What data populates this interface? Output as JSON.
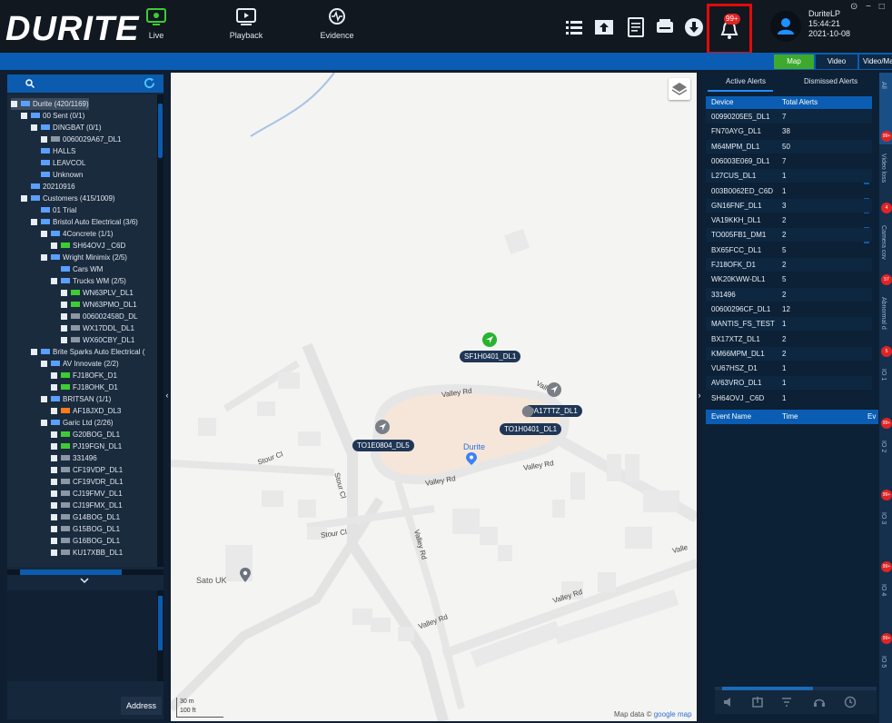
{
  "app": {
    "brand": "DURITE",
    "registered_mark": "®",
    "accent": "#0a5db2",
    "alert_color": "#e02424"
  },
  "nav": [
    {
      "label": "Live",
      "icon": "live-icon"
    },
    {
      "label": "Playback",
      "icon": "playback-icon"
    },
    {
      "label": "Evidence",
      "icon": "evidence-icon"
    }
  ],
  "header_icons": [
    "list-icon",
    "upload-icon",
    "report-icon",
    "printer-icon",
    "download-icon",
    "bell-icon"
  ],
  "bell": {
    "badge": "99+"
  },
  "user": {
    "name": "DuriteLP",
    "time": "15:44:21",
    "date": "2021-10-08"
  },
  "window_controls": "⊙ − □",
  "view_tabs": {
    "map": "Map",
    "video": "Video",
    "videomap": "Video/Ma"
  },
  "tree": [
    {
      "label": "Durite (420/1169)",
      "level": 0,
      "icon": "group"
    },
    {
      "label": "00 Sent (0/1)",
      "level": 1,
      "icon": "group"
    },
    {
      "label": "DINGBAT (0/1)",
      "level": 2,
      "icon": "group"
    },
    {
      "label": "0060029A67_DL1",
      "level": 3,
      "icon": "vehicle-grey"
    },
    {
      "label": "HALLS",
      "level": 2,
      "icon": "group"
    },
    {
      "label": "LEAVCOL",
      "level": 2,
      "icon": "group"
    },
    {
      "label": "Unknown",
      "level": 2,
      "icon": "group"
    },
    {
      "label": "20210916",
      "level": 1,
      "icon": "group"
    },
    {
      "label": "Customers (415/1009)",
      "level": 1,
      "icon": "group"
    },
    {
      "label": "01 Trial",
      "level": 2,
      "icon": "group"
    },
    {
      "label": "Bristol Auto Electrical (3/6)",
      "level": 2,
      "icon": "group"
    },
    {
      "label": "4Concrete (1/1)",
      "level": 3,
      "icon": "group"
    },
    {
      "label": "SH64OVJ _C6D",
      "level": 4,
      "icon": "vehicle-green"
    },
    {
      "label": "Wright Minimix (2/5)",
      "level": 3,
      "icon": "group"
    },
    {
      "label": "Cars WM",
      "level": 4,
      "icon": "group"
    },
    {
      "label": "Trucks WM (2/5)",
      "level": 4,
      "icon": "group"
    },
    {
      "label": "WN63PLV_DL1",
      "level": 5,
      "icon": "vehicle-green"
    },
    {
      "label": "WN63PMO_DL1",
      "level": 5,
      "icon": "vehicle-green"
    },
    {
      "label": "006002458D_DL",
      "level": 5,
      "icon": "vehicle-grey"
    },
    {
      "label": "WX17DDL_DL1",
      "level": 5,
      "icon": "vehicle-grey"
    },
    {
      "label": "WX60CBY_DL1",
      "level": 5,
      "icon": "vehicle-grey"
    },
    {
      "label": "Brite Sparks Auto Electrical (",
      "level": 2,
      "icon": "group"
    },
    {
      "label": "AV Innovate (2/2)",
      "level": 3,
      "icon": "group"
    },
    {
      "label": "FJ18OFK_D1",
      "level": 4,
      "icon": "vehicle-green"
    },
    {
      "label": "FJ18OHK_D1",
      "level": 4,
      "icon": "vehicle-green"
    },
    {
      "label": "BRITSAN (1/1)",
      "level": 3,
      "icon": "group"
    },
    {
      "label": "AF18JXD_DL3",
      "level": 4,
      "icon": "vehicle-orange"
    },
    {
      "label": "Garic Ltd (2/26)",
      "level": 3,
      "icon": "group"
    },
    {
      "label": "G20BOG_DL1",
      "level": 4,
      "icon": "vehicle-green"
    },
    {
      "label": "PJ19FGN_DL1",
      "level": 4,
      "icon": "vehicle-green"
    },
    {
      "label": "331496",
      "level": 4,
      "icon": "vehicle-grey"
    },
    {
      "label": "CF19VDP_DL1",
      "level": 4,
      "icon": "vehicle-grey"
    },
    {
      "label": "CF19VDR_DL1",
      "level": 4,
      "icon": "vehicle-grey"
    },
    {
      "label": "CJ19FMV_DL1",
      "level": 4,
      "icon": "vehicle-grey"
    },
    {
      "label": "CJ19FMX_DL1",
      "level": 4,
      "icon": "vehicle-grey"
    },
    {
      "label": "G14BOG_DL1",
      "level": 4,
      "icon": "vehicle-grey"
    },
    {
      "label": "G15BOG_DL1",
      "level": 4,
      "icon": "vehicle-grey"
    },
    {
      "label": "G16BOG_DL1",
      "level": 4,
      "icon": "vehicle-grey"
    },
    {
      "label": "KU17XBB_DL1",
      "level": 4,
      "icon": "vehicle-grey"
    }
  ],
  "address_button": "Address",
  "map": {
    "roads": [
      "Valley Rd",
      "Valley Rd",
      "Valley Rd",
      "Valley Rd",
      "Valley Rd",
      "Valley Rd",
      "Stour Cl",
      "Stour Cl",
      "Stour Cl",
      "Vall",
      "Valle"
    ],
    "places": [
      "Durite",
      "Sato UK"
    ],
    "vehicles": [
      "SF1H0401_DL1",
      "DA17TTZ_DL1",
      "TO1H0401_DL1",
      "TO1E0804_DL5"
    ],
    "scale": [
      "30 m",
      "100 ft"
    ],
    "attribution": "Map data ©",
    "attribution_link": "google map"
  },
  "alerts": {
    "tabs": [
      "Active Alerts",
      "Dismissed Alerts"
    ],
    "columns": [
      "Device",
      "Total Alerts"
    ],
    "rows": [
      [
        "00990205E5_DL1",
        "7"
      ],
      [
        "FN70AYG_DL1",
        "38"
      ],
      [
        "M64MPM_DL1",
        "50"
      ],
      [
        "006003E069_DL1",
        "7"
      ],
      [
        "L27CUS_DL1",
        "1"
      ],
      [
        "003B0062ED_C6D",
        "1"
      ],
      [
        "GN16FNF_DL1",
        "3"
      ],
      [
        "VA19KKH_DL1",
        "2"
      ],
      [
        "TO005FB1_DM1",
        "2"
      ],
      [
        "BX65FCC_DL1",
        "5"
      ],
      [
        "FJ18OFK_D1",
        "2"
      ],
      [
        "WK20KWW-DL1",
        "5"
      ],
      [
        "331496",
        "2"
      ],
      [
        "00600296CF_DL1",
        "12"
      ],
      [
        "MANTIS_FS_TEST",
        "1"
      ],
      [
        "BX17XTZ_DL1",
        "2"
      ],
      [
        "KM66MPM_DL1",
        "2"
      ],
      [
        "VU67HSZ_D1",
        "1"
      ],
      [
        "AV63VRO_DL1",
        "1"
      ],
      [
        "SH64OVJ _C6D",
        "1"
      ]
    ],
    "event_columns": [
      "Event Name",
      "Time",
      "Ev"
    ]
  },
  "vtabs": [
    {
      "label": "All",
      "badge": "99+"
    },
    {
      "label": "Video loss",
      "badge": "4"
    },
    {
      "label": "Camera cov",
      "badge": "57"
    },
    {
      "label": "Abnormal d",
      "badge": "5"
    },
    {
      "label": "IO 1",
      "badge": "99+"
    },
    {
      "label": "IO 2",
      "badge": "99+"
    },
    {
      "label": "IO 3",
      "badge": "99+"
    },
    {
      "label": "IO 4",
      "badge": "99+"
    },
    {
      "label": "IO 5",
      "badge": ""
    }
  ]
}
